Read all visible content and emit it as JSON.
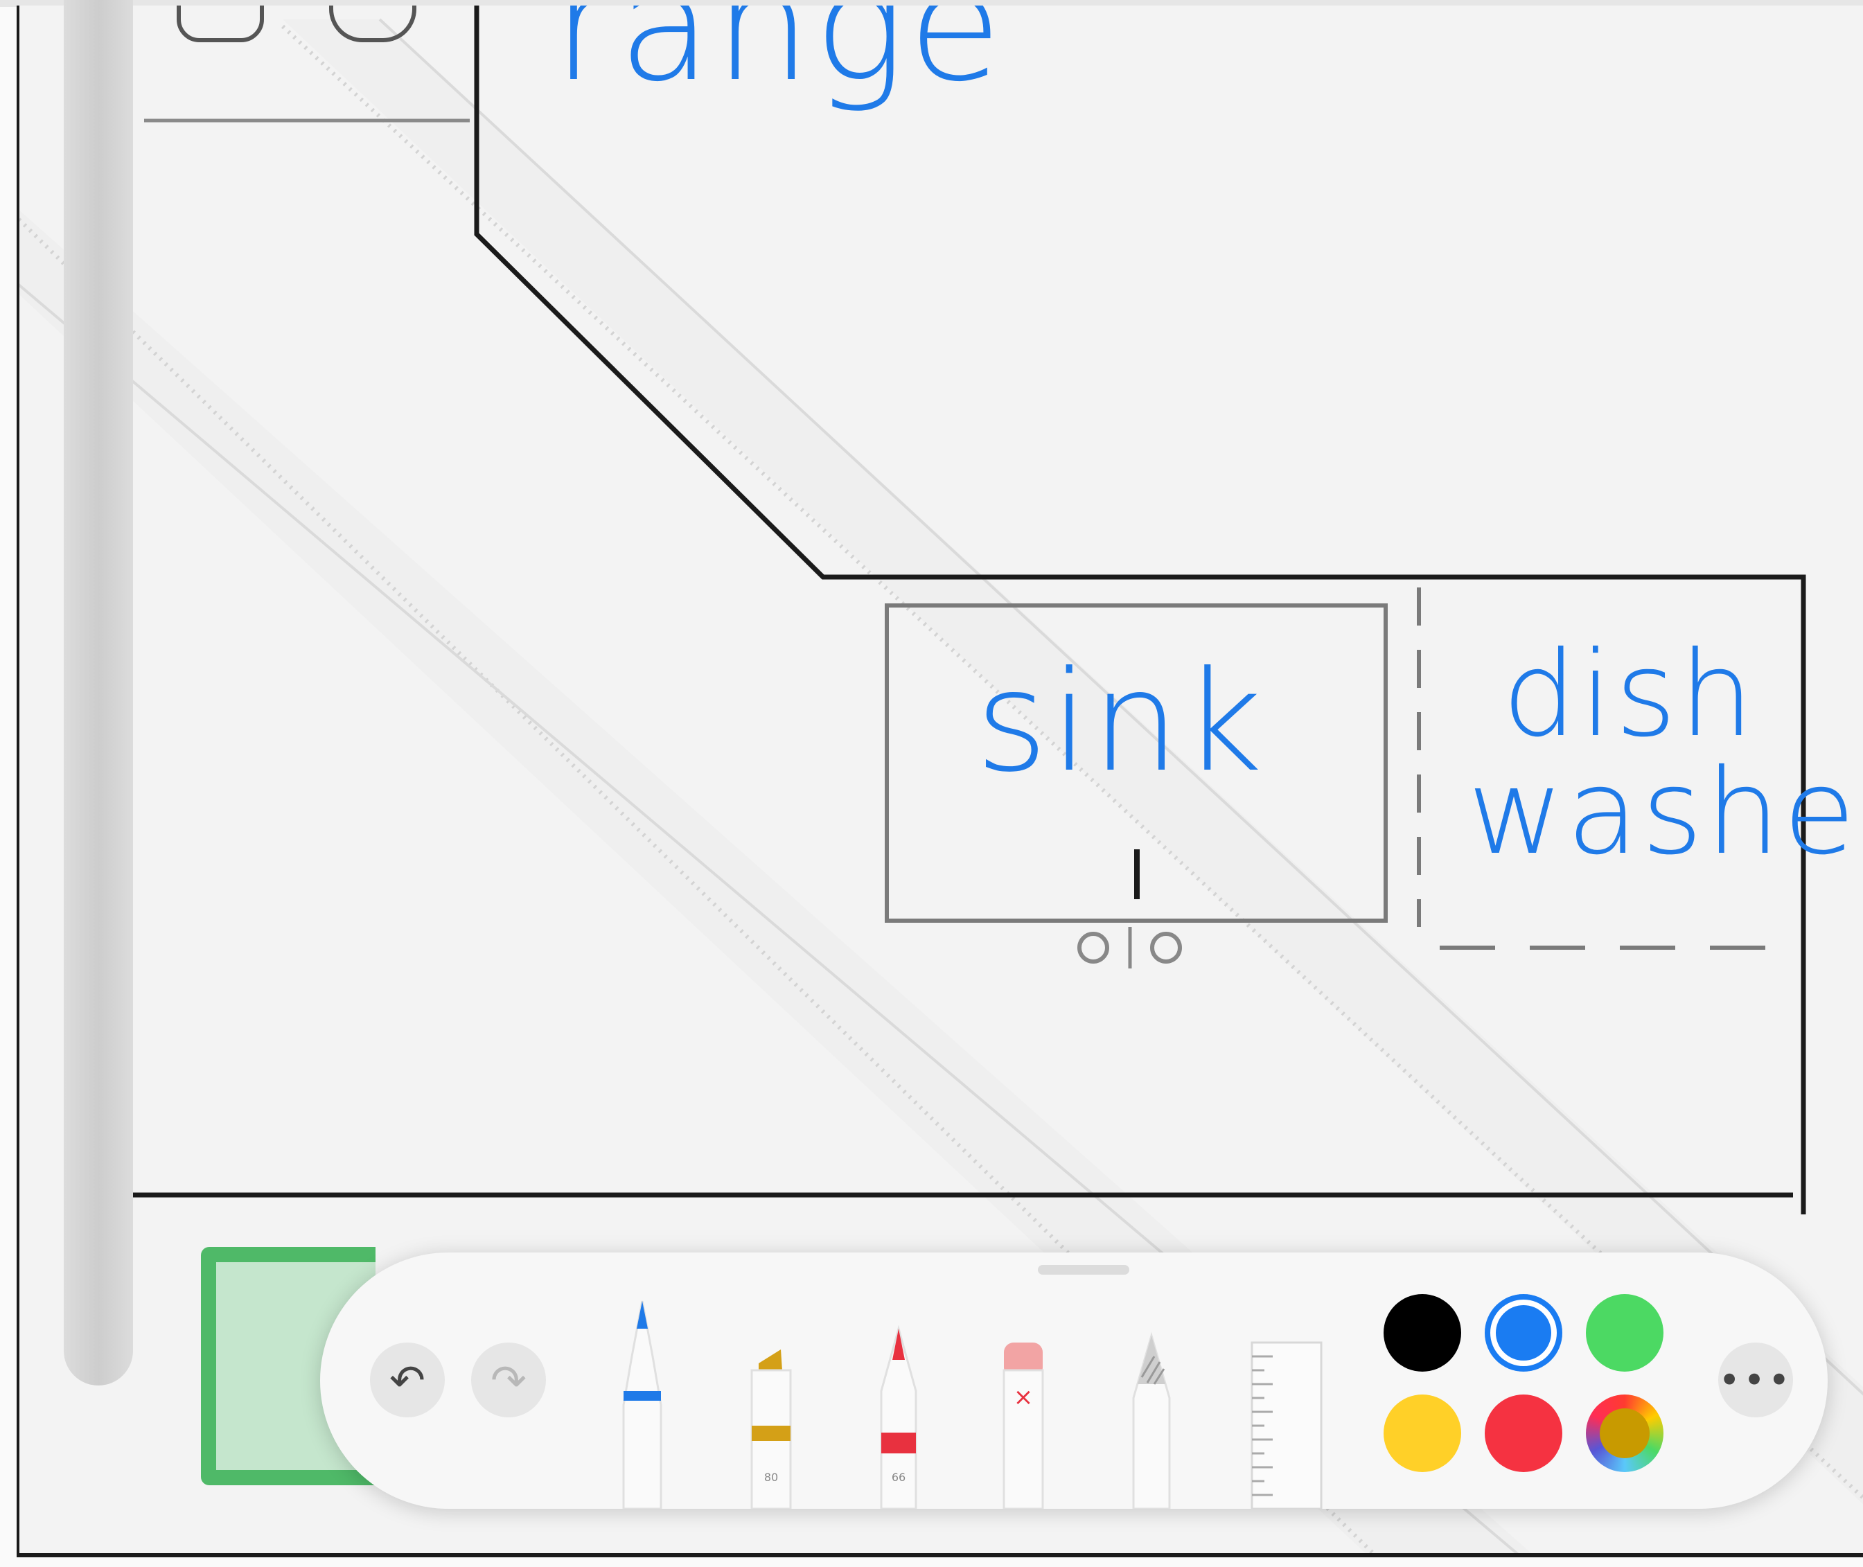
{
  "drawing": {
    "labels": {
      "range": "range",
      "sink": "sink",
      "dish": "dish",
      "washer": "washer"
    },
    "ink_color": "#1f7ae8"
  },
  "toolbar": {
    "undo_icon": "undo-arrow-icon",
    "redo_icon": "redo-arrow-icon",
    "more_label": "•••",
    "tools": [
      {
        "name": "pen",
        "tip_color": "#1f7ae8"
      },
      {
        "name": "marker",
        "tip_color": "#d4a017",
        "size_label": "80"
      },
      {
        "name": "pencil",
        "tip_color": "#e8313f",
        "size_label": "66"
      },
      {
        "name": "eraser",
        "tip_color": "#f2a4a4"
      },
      {
        "name": "lasso"
      },
      {
        "name": "ruler"
      }
    ],
    "colors": [
      {
        "name": "black",
        "hex": "#000000"
      },
      {
        "name": "blue",
        "hex": "#1a7cf2",
        "selected": true
      },
      {
        "name": "green",
        "hex": "#4cd963"
      },
      {
        "name": "yellow",
        "hex": "#ffd028"
      },
      {
        "name": "red",
        "hex": "#f53241"
      },
      {
        "name": "color-picker",
        "hex": "multicolor"
      }
    ]
  }
}
